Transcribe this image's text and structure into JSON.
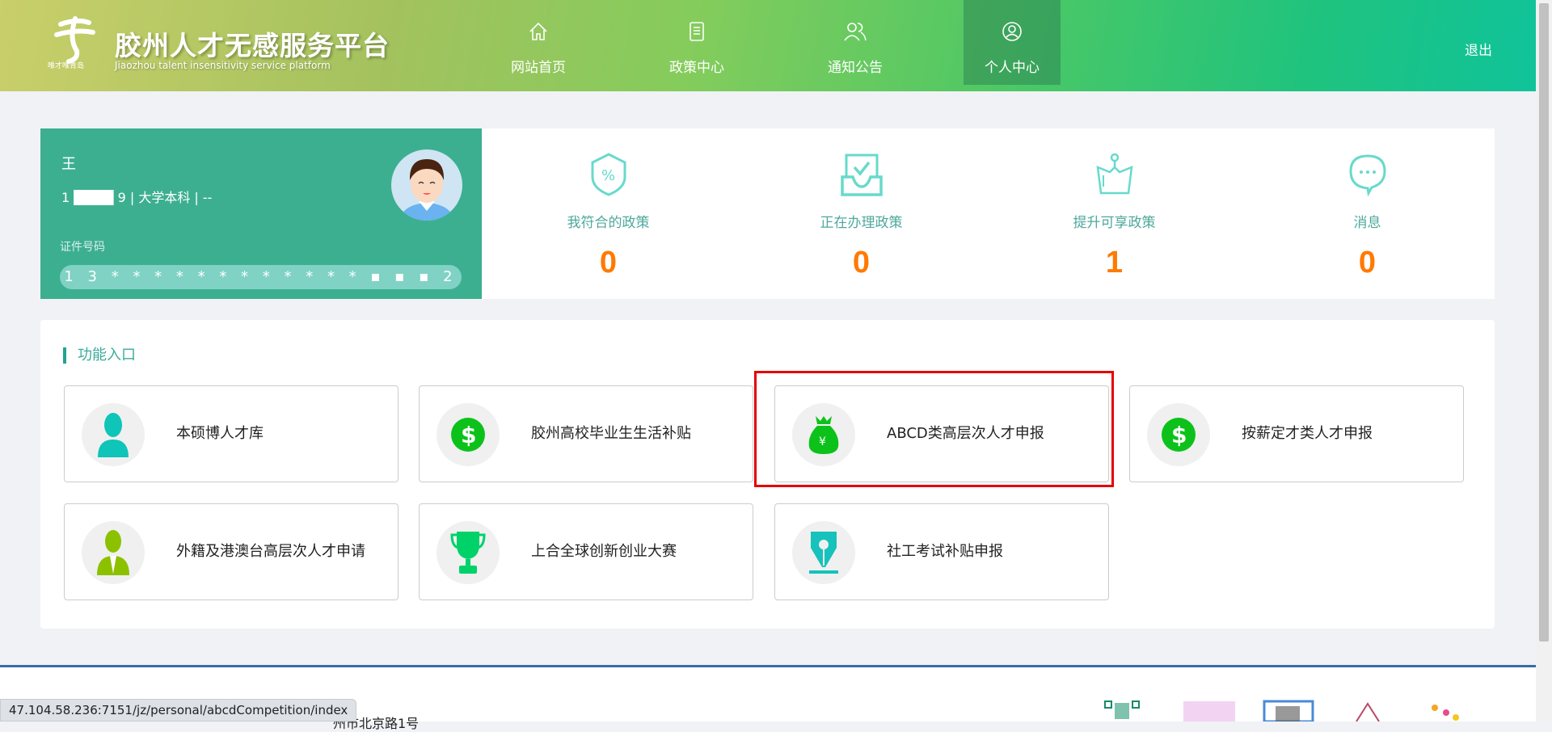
{
  "header": {
    "title": "胶州人才无感服务平台",
    "subtitle": "Jiaozhou talent insensitivity service platform",
    "logo_text": "唯才唯青岛",
    "logout": "退出",
    "nav": [
      {
        "label": "网站首页",
        "icon": "home-icon"
      },
      {
        "label": "政策中心",
        "icon": "document-icon"
      },
      {
        "label": "通知公告",
        "icon": "users-icon"
      },
      {
        "label": "个人中心",
        "icon": "user-circle-icon",
        "active": true
      }
    ]
  },
  "profile": {
    "name": "王",
    "info": "1 ████ 9 | 大学本科 | --",
    "id_label": "证件号码",
    "id_value": "1 3 * * * * * * * * * * * * ▪ ▪ ▪ 2"
  },
  "stats": [
    {
      "label": "我符合的政策",
      "value": "0",
      "icon": "shield-percent-icon"
    },
    {
      "label": "正在办理政策",
      "value": "0",
      "icon": "inbox-check-icon"
    },
    {
      "label": "提升可享政策",
      "value": "1",
      "icon": "crown-icon"
    },
    {
      "label": "消息",
      "value": "0",
      "icon": "chat-bubble-icon"
    }
  ],
  "functions": {
    "title": "功能入口",
    "items": [
      {
        "label": "本硕博人才库",
        "icon": "person-icon",
        "color": "#0fc4b8"
      },
      {
        "label": "胶州高校毕业生生活补贴",
        "icon": "dollar-icon",
        "color": "#0cc21a"
      },
      {
        "label": "ABCD类高层次人才申报",
        "icon": "money-bag-icon",
        "color": "#0cc21a",
        "highlighted": true
      },
      {
        "label": "按薪定才类人才申报",
        "icon": "dollar-icon",
        "color": "#0cc21a"
      },
      {
        "label": "外籍及港澳台高层次人才申请",
        "icon": "businessman-icon",
        "color": "#8cc100"
      },
      {
        "label": "上合全球创新创业大赛",
        "icon": "trophy-icon",
        "color": "#00d26a"
      },
      {
        "label": "社工考试补贴申报",
        "icon": "pen-nib-icon",
        "color": "#16c2bb"
      }
    ]
  },
  "footer": {
    "address": "州市北京路1号"
  },
  "status_bar": {
    "url": "47.104.58.236:7151/jz/personal/abcdCompetition/index"
  },
  "colors": {
    "accent": "#3daf91",
    "number": "#ff7a00",
    "highlight": "#e60000"
  }
}
